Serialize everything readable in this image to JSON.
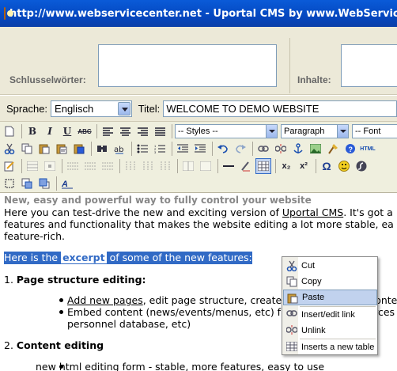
{
  "window": {
    "title": "http://www.webservicecenter.net - Uportal CMS by www.WebServiceCenter.net"
  },
  "meta": {
    "keywords_label": "Schlusselwörter:",
    "content_label": "Inhalte:"
  },
  "form": {
    "language_label": "Sprache:",
    "language_value": "Englisch",
    "title_label": "Titel:",
    "title_value": "WELCOME TO DEMO WEBSITE"
  },
  "toolbar": {
    "styles_value": "-- Styles --",
    "format_value": "Paragraph",
    "font_value": "-- Font",
    "bold_label": "B",
    "italic_label": "I",
    "underline_label": "U",
    "strike_label": "ABC",
    "subscript_label": "x₂",
    "superscript_label": "x²",
    "omega_label": "Ω"
  },
  "editor": {
    "heading": "New, easy and powerful way to fully control your website",
    "intro_1a": "Here you can test-drive the new and exciting version of ",
    "intro_1b": "Uportal CMS",
    "intro_1c": ". It's got a",
    "intro_2": "features and functionality that makes the website editing a lot more stable, ea",
    "intro_3": "feature-rich.",
    "selected_a": "Here is the ",
    "selected_b": "excerpt",
    "selected_c": " of some of the new features:",
    "section1_num": "1. ",
    "section1_title": "Page structure editing:",
    "s1_b1_link": "Add new pages",
    "s1_b1_rest": ", edit page structure, create",
    "s1_b1_tail": "onte",
    "s1_b2": "Embed content (news/events/menus, etc) f",
    "s1_b2_tail": "rces",
    "s1_b2_cont": "personnel database, etc)",
    "section2_num": "2. ",
    "section2_title": "Content editing",
    "s2_b1a": "new ",
    "s2_b1_link": "html",
    "s2_b1b": " editing form - stable, more features, easy to use"
  },
  "context_menu": {
    "items": [
      {
        "label": "Cut",
        "icon": "scissors-icon"
      },
      {
        "label": "Copy",
        "icon": "copy-icon"
      },
      {
        "label": "Paste",
        "icon": "paste-icon"
      },
      {
        "label": "Insert/edit link",
        "icon": "link-icon"
      },
      {
        "label": "Unlink",
        "icon": "unlink-icon"
      },
      {
        "label": "Inserts a new table",
        "icon": "table-icon"
      }
    ]
  },
  "colors": {
    "titlebar": "#0a5bd8",
    "selection": "#316ac5",
    "menu_hover": "#c1d2ee",
    "chrome": "#ece9d8"
  }
}
